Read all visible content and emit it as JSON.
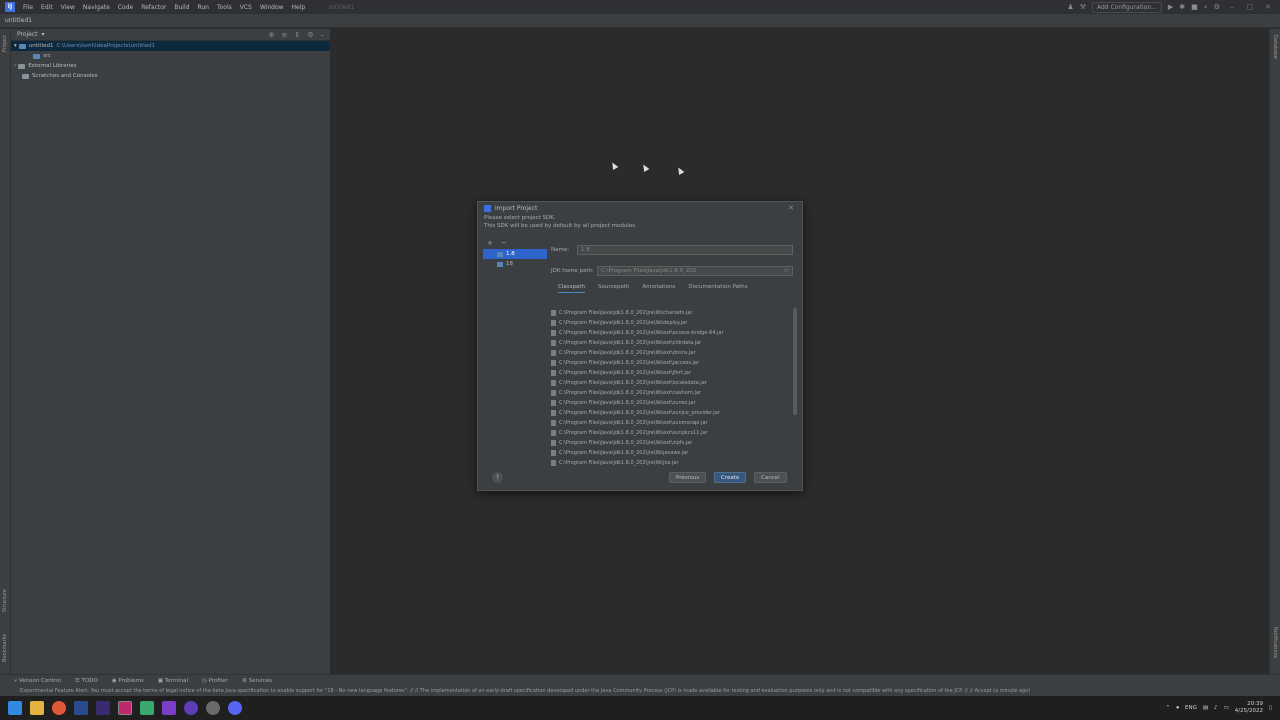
{
  "menubar": {
    "app_logo": "IJ",
    "items": [
      "File",
      "Edit",
      "View",
      "Navigate",
      "Code",
      "Refactor",
      "Build",
      "Run",
      "Tools",
      "VCS",
      "Window",
      "Help"
    ],
    "title": "untitled1",
    "add_configuration": "Add Configuration..."
  },
  "navbar": {
    "breadcrumb": "untitled1"
  },
  "left_stripe": {
    "project": "Project",
    "structure": "Structure",
    "bookmarks": "Bookmarks"
  },
  "right_stripe": {
    "database": "Database",
    "notifications": "Notifications"
  },
  "project_panel": {
    "header": "Project",
    "tree": [
      {
        "label": "untitled1",
        "path": "C:\\Users\\lumi\\IdeaProjects\\untitled1"
      },
      {
        "label": "src",
        "path": ""
      },
      {
        "label": "External Libraries",
        "path": ""
      },
      {
        "label": "Scratches and Consoles",
        "path": ""
      }
    ]
  },
  "dialog": {
    "title": "Import Project",
    "desc_line1": "Please select project SDK.",
    "desc_line2": "This SDK will be used by default by all project modules.",
    "sdk_items": [
      "1.8",
      "18"
    ],
    "name_label": "Name:",
    "name_value": "1.8",
    "home_label": "JDK home path:",
    "home_value": "C:\\Program Files\\Java\\jdk1.8.0_202",
    "tabs": [
      "Classpath",
      "Sourcepath",
      "Annotations",
      "Documentation Paths"
    ],
    "classpath": [
      "C:\\Program Files\\Java\\jdk1.8.0_202\\jre\\lib\\charsets.jar",
      "C:\\Program Files\\Java\\jdk1.8.0_202\\jre\\lib\\deploy.jar",
      "C:\\Program Files\\Java\\jdk1.8.0_202\\jre\\lib\\ext\\access-bridge-64.jar",
      "C:\\Program Files\\Java\\jdk1.8.0_202\\jre\\lib\\ext\\cldrdata.jar",
      "C:\\Program Files\\Java\\jdk1.8.0_202\\jre\\lib\\ext\\dnsns.jar",
      "C:\\Program Files\\Java\\jdk1.8.0_202\\jre\\lib\\ext\\jaccess.jar",
      "C:\\Program Files\\Java\\jdk1.8.0_202\\jre\\lib\\ext\\jfxrt.jar",
      "C:\\Program Files\\Java\\jdk1.8.0_202\\jre\\lib\\ext\\localedata.jar",
      "C:\\Program Files\\Java\\jdk1.8.0_202\\jre\\lib\\ext\\nashorn.jar",
      "C:\\Program Files\\Java\\jdk1.8.0_202\\jre\\lib\\ext\\sunec.jar",
      "C:\\Program Files\\Java\\jdk1.8.0_202\\jre\\lib\\ext\\sunjce_provider.jar",
      "C:\\Program Files\\Java\\jdk1.8.0_202\\jre\\lib\\ext\\sunmscapi.jar",
      "C:\\Program Files\\Java\\jdk1.8.0_202\\jre\\lib\\ext\\sunpkcs11.jar",
      "C:\\Program Files\\Java\\jdk1.8.0_202\\jre\\lib\\ext\\zipfs.jar",
      "C:\\Program Files\\Java\\jdk1.8.0_202\\jre\\lib\\javaws.jar",
      "C:\\Program Files\\Java\\jdk1.8.0_202\\jre\\lib\\jce.jar"
    ],
    "help": "?",
    "previous": "Previous",
    "create": "Create",
    "cancel": "Cancel"
  },
  "bottom_tools": [
    "Version Control",
    "TODO",
    "Problems",
    "Terminal",
    "Profiler",
    "Services"
  ],
  "status_text": "Experimental Feature Alert: You must accept the terms of legal notice of the beta Java specification to enable support for \"18 - No new language features\". // // The implementation of an early-draft specification developed under the Java Community Process (JCP) is made available for testing and evaluation purposes only and is not compatible with any specification of the JCP. // // Accept (a minute ago)",
  "tray": {
    "lang": "ENG",
    "time": "20:39",
    "date": "4/25/2022"
  },
  "colors": {
    "accent": "#2f65ca",
    "primary_button": "#365880",
    "background": "#2b2b2b",
    "panel": "#3c3f41"
  }
}
